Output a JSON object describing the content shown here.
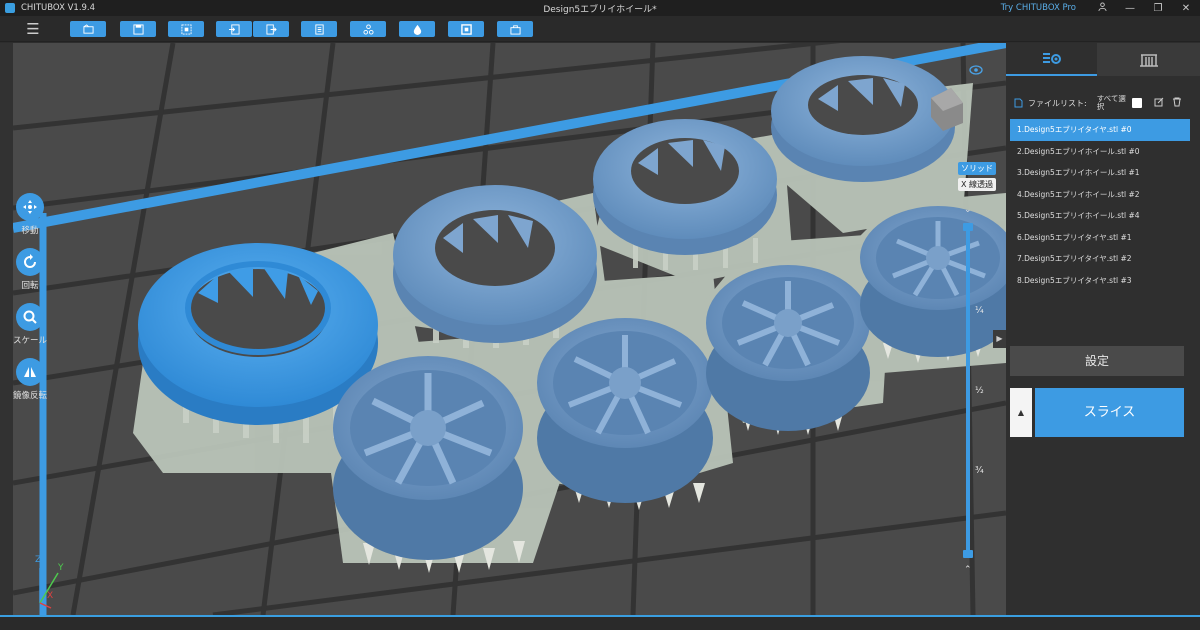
{
  "titlebar": {
    "app_name": "CHITUBOX V1.9.4",
    "document": "Design5エブリイホイール*",
    "try_pro": "Try CHITUBOX Pro"
  },
  "left_tools": [
    {
      "label": "移動",
      "icon": "move-icon"
    },
    {
      "label": "回転",
      "icon": "rotate-icon"
    },
    {
      "label": "スケール",
      "icon": "scale-icon"
    },
    {
      "label": "鏡像反転",
      "icon": "mirror-icon"
    }
  ],
  "view_mode": {
    "solid": "ソリッド",
    "xray": "X 線透過"
  },
  "slider": {
    "quarter": "¼",
    "half": "½",
    "three_quarter": "¾"
  },
  "panel": {
    "file_list_label": "ファイルリスト:",
    "select_all_label": "すべて選択",
    "files": [
      "1.Design5エブリイタイヤ.stl #0",
      "2.Design5エブリイホイール.stl #0",
      "3.Design5エブリイホイール.stl #1",
      "4.Design5エブリイホイール.stl #2",
      "5.Design5エブリイホイール.stl #4",
      "6.Design5エブリイタイヤ.stl #1",
      "7.Design5エブリイタイヤ.stl #2",
      "8.Design5エブリイタイヤ.stl #3"
    ],
    "settings_label": "設定",
    "slice_label": "スライス"
  },
  "axis": {
    "x": "X",
    "y": "Y",
    "z": "Z"
  },
  "colors": {
    "accent": "#3d9be3",
    "model": "#6f9fcc",
    "model_selected": "#3f9ce6",
    "support_pad": "#b9c4b8",
    "bed": "#4a4a4a"
  }
}
